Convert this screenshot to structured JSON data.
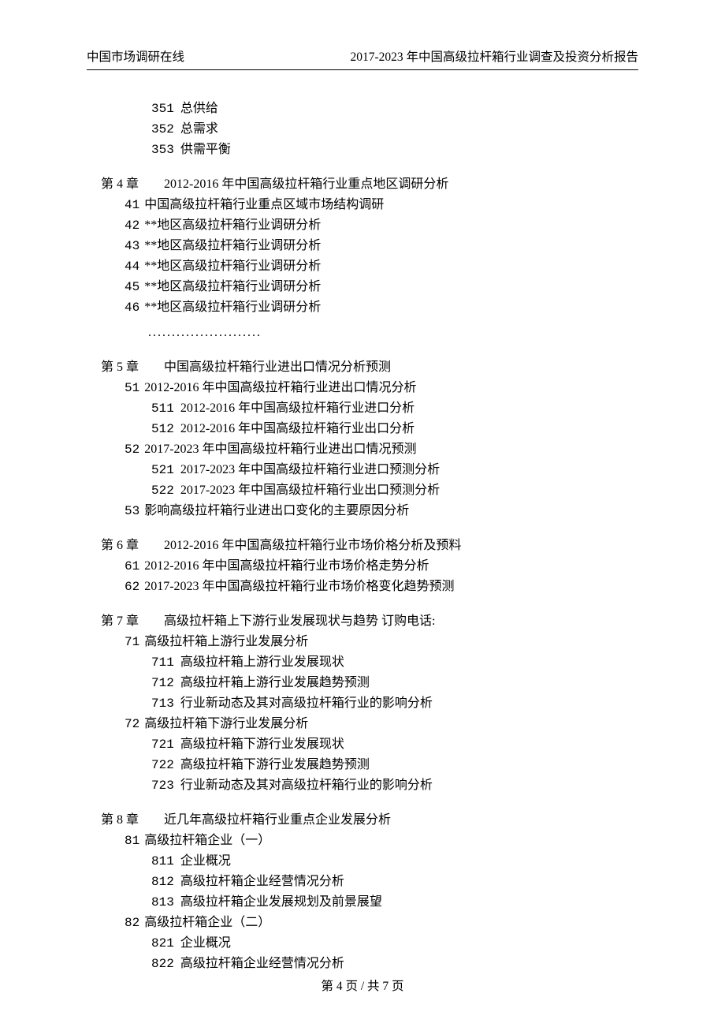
{
  "header": {
    "left": "中国市场调研在线",
    "right": "2017-2023 年中国高级拉杆箱行业调查及投资分析报告"
  },
  "footer": {
    "text": "第 4 页 / 共 7 页"
  },
  "pre_items": [
    {
      "num": "351",
      "text": "总供给"
    },
    {
      "num": "352",
      "text": "总需求"
    },
    {
      "num": "353",
      "text": "供需平衡"
    }
  ],
  "chapters": [
    {
      "label": "第 4 章",
      "title": "2012-2016 年中国高级拉杆箱行业重点地区调研分析",
      "items": [
        {
          "num": "41",
          "text": "中国高级拉杆箱行业重点区域市场结构调研"
        },
        {
          "num": "42",
          "text": "**地区高级拉杆箱行业调研分析"
        },
        {
          "num": "43",
          "text": "**地区高级拉杆箱行业调研分析"
        },
        {
          "num": "44",
          "text": "**地区高级拉杆箱行业调研分析"
        },
        {
          "num": "45",
          "text": "**地区高级拉杆箱行业调研分析"
        },
        {
          "num": "46",
          "text": "**地区高级拉杆箱行业调研分析"
        }
      ],
      "dots": "........................"
    },
    {
      "label": "第 5 章",
      "title": "中国高级拉杆箱行业进出口情况分析预测",
      "items": [
        {
          "num": "51",
          "text": "2012-2016 年中国高级拉杆箱行业进出口情况分析",
          "sub": [
            {
              "num": "511",
              "text": "2012-2016 年中国高级拉杆箱行业进口分析"
            },
            {
              "num": "512",
              "text": "2012-2016 年中国高级拉杆箱行业出口分析"
            }
          ]
        },
        {
          "num": "52",
          "text": "2017-2023 年中国高级拉杆箱行业进出口情况预测",
          "sub": [
            {
              "num": "521",
              "text": "2017-2023 年中国高级拉杆箱行业进口预测分析"
            },
            {
              "num": "522",
              "text": "2017-2023 年中国高级拉杆箱行业出口预测分析"
            }
          ]
        },
        {
          "num": "53",
          "text": "影响高级拉杆箱行业进出口变化的主要原因分析"
        }
      ]
    },
    {
      "label": "第 6 章",
      "title": "2012-2016 年中国高级拉杆箱行业市场价格分析及预料",
      "items": [
        {
          "num": "61",
          "text": "2012-2016 年中国高级拉杆箱行业市场价格走势分析"
        },
        {
          "num": "62",
          "text": "2017-2023 年中国高级拉杆箱行业市场价格变化趋势预测"
        }
      ]
    },
    {
      "label": "第 7 章",
      "title": "高级拉杆箱上下游行业发展现状与趋势  订购电话:",
      "items": [
        {
          "num": "71",
          "text": "高级拉杆箱上游行业发展分析",
          "sub": [
            {
              "num": "711",
              "text": "高级拉杆箱上游行业发展现状"
            },
            {
              "num": "712",
              "text": "高级拉杆箱上游行业发展趋势预测"
            },
            {
              "num": "713",
              "text": "行业新动态及其对高级拉杆箱行业的影响分析"
            }
          ]
        },
        {
          "num": "72",
          "text": "高级拉杆箱下游行业发展分析",
          "sub": [
            {
              "num": "721",
              "text": "高级拉杆箱下游行业发展现状"
            },
            {
              "num": "722",
              "text": "高级拉杆箱下游行业发展趋势预测"
            },
            {
              "num": "723",
              "text": "行业新动态及其对高级拉杆箱行业的影响分析"
            }
          ]
        }
      ]
    },
    {
      "label": "第 8 章",
      "title": "近几年高级拉杆箱行业重点企业发展分析",
      "items": [
        {
          "num": "81",
          "text": "高级拉杆箱企业（一）",
          "sub": [
            {
              "num": "811",
              "text": "企业概况"
            },
            {
              "num": "812",
              "text": "高级拉杆箱企业经营情况分析"
            },
            {
              "num": "813",
              "text": "高级拉杆箱企业发展规划及前景展望"
            }
          ]
        },
        {
          "num": "82",
          "text": "高级拉杆箱企业（二）",
          "sub": [
            {
              "num": "821",
              "text": "企业概况"
            },
            {
              "num": "822",
              "text": "高级拉杆箱企业经营情况分析"
            }
          ]
        }
      ]
    }
  ]
}
